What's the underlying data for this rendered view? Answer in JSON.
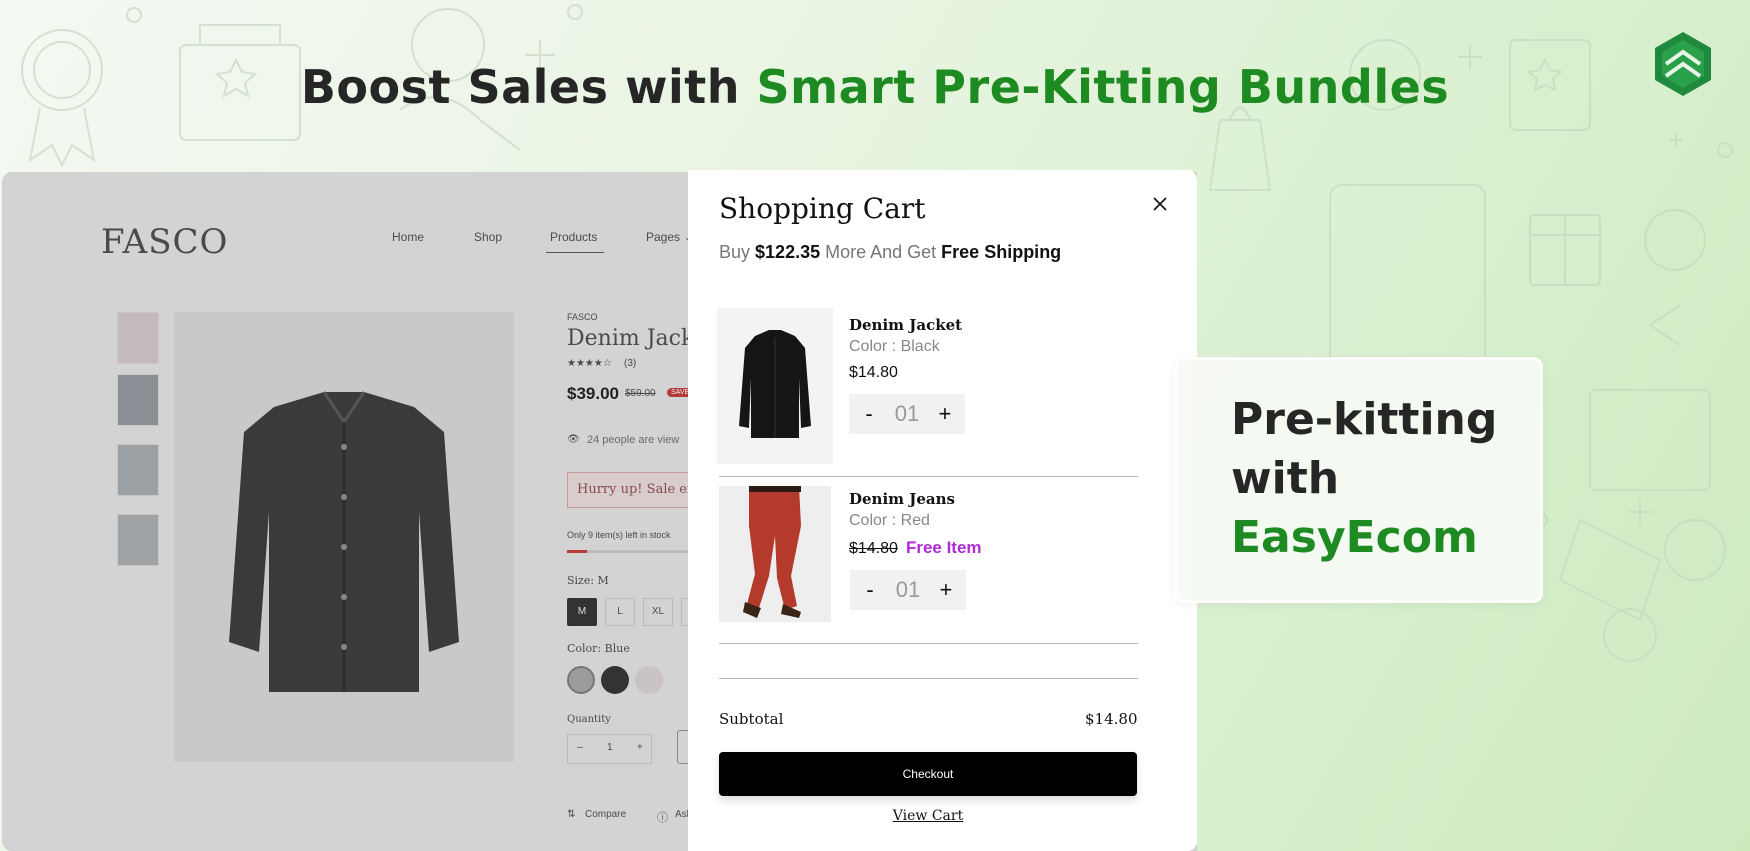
{
  "headline": {
    "part1": "Boost Sales with ",
    "part2": "Smart Pre-Kitting Bundles"
  },
  "colors": {
    "accent_green": "#1e8a22",
    "free_item_purple": "#b02bd6",
    "checkout_bg": "#000000"
  },
  "store": {
    "logo": "FASCO",
    "nav": [
      "Home",
      "Shop",
      "Products",
      "Pages"
    ],
    "active_nav": "Products",
    "product": {
      "brand": "FASCO",
      "name": "Denim Jacke",
      "rating_count": "(3)",
      "price": "$39.00",
      "old_price": "$59.00",
      "sale_badge": "SAVE",
      "viewers": "24 people are view",
      "hurry": "Hurry up! Sale ends",
      "stock": "Only 9 item(s) left in stock",
      "size_label": "Size: M",
      "sizes": [
        "M",
        "L",
        "XL",
        "X"
      ],
      "color_label": "Color: Blue",
      "quantity_label": "Quantity",
      "quantity_minus": "–",
      "quantity_value": "1",
      "quantity_plus": "+",
      "compare": "Compare",
      "ask": "Ask"
    }
  },
  "cart": {
    "title": "Shopping Cart",
    "shipping_prefix": "Buy ",
    "shipping_amount": "$122.35",
    "shipping_middle": " More And Get ",
    "shipping_bold": "Free Shipping",
    "items": [
      {
        "name": "Denim Jacket",
        "variant": "Color : Black",
        "price": "$14.80",
        "qty": "01",
        "minus": "-",
        "plus": "+"
      },
      {
        "name": "Denim Jeans",
        "variant": "Color : Red",
        "old_price": "$14.80",
        "free_label": "Free Item",
        "qty": "01",
        "minus": "-",
        "plus": "+"
      }
    ],
    "subtotal_label": "Subtotal",
    "subtotal_value": "$14.80",
    "checkout_label": "Checkout",
    "view_cart_label": "View Cart"
  },
  "callout": {
    "line1": "Pre-kitting",
    "line2": "with",
    "line3": "EasyEcom"
  }
}
